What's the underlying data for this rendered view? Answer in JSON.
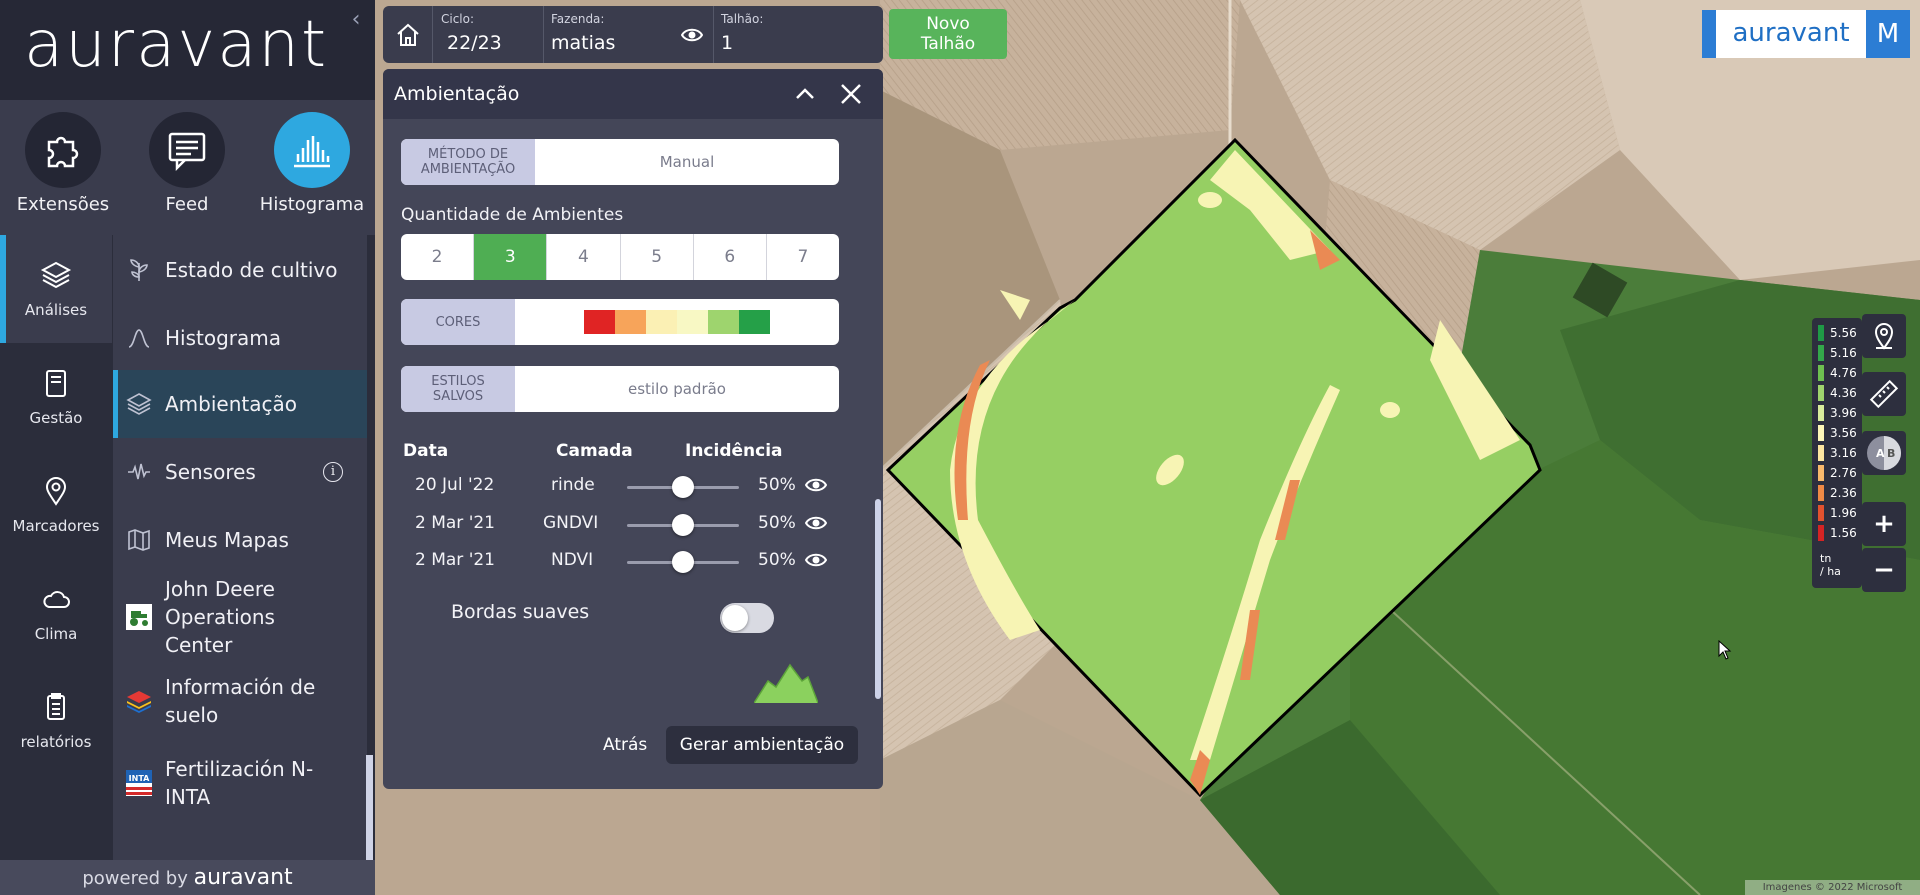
{
  "app": {
    "logo_text": "auravant",
    "collapse": "‹"
  },
  "top_apps": [
    {
      "label": "Extensões",
      "icon": "puzzle-icon"
    },
    {
      "label": "Feed",
      "icon": "chat-icon"
    },
    {
      "label": "Histograma",
      "icon": "histogram-icon"
    }
  ],
  "rail": [
    {
      "label": "Análises",
      "icon": "layers-icon",
      "active": true
    },
    {
      "label": "Gestão",
      "icon": "clipboard-icon"
    },
    {
      "label": "Marcadores",
      "icon": "pin-icon"
    },
    {
      "label": "Clima",
      "icon": "cloud-icon"
    },
    {
      "label": "relatórios",
      "icon": "report-icon"
    }
  ],
  "menu": [
    {
      "label": "Estado de cultivo",
      "icon": "plant-icon"
    },
    {
      "label": "Histograma",
      "icon": "curve-icon"
    },
    {
      "label": "Ambientação",
      "icon": "layers-icon",
      "active": true
    },
    {
      "label": "Sensores",
      "icon": "pulse-icon",
      "info": "i"
    },
    {
      "label": "Meus Mapas",
      "icon": "map-icon"
    },
    {
      "label": "John Deere Operations Center",
      "icon": "tractor-icon"
    },
    {
      "label": "Información de suelo",
      "icon": "soil-layers-icon"
    },
    {
      "label": "Fertilización N-INTA",
      "icon": "inta-icon",
      "badge": "INTA"
    }
  ],
  "powered": {
    "prefix": "powered by",
    "brand": "auravant"
  },
  "topbar": {
    "ciclo_caption": "Ciclo:",
    "ciclo_value": "22/23",
    "fazenda_caption": "Fazenda:",
    "fazenda_value": "matias",
    "talhao_caption": "Talhão:",
    "talhao_value": "1"
  },
  "novo_talhao": {
    "line1": "Novo",
    "line2": "Talhão"
  },
  "panel": {
    "title": "Ambientação",
    "metodo_label_1": "MÉTODO DE",
    "metodo_label_2": "AMBIENTAÇÃO",
    "metodo_value": "Manual",
    "qtd_label": "Quantidade de Ambientes",
    "qtd_options": [
      "2",
      "3",
      "4",
      "5",
      "6",
      "7"
    ],
    "qtd_selected": "3",
    "cores_label": "CORES",
    "cores": [
      "#e02424",
      "#f7a45a",
      "#fbf0b4",
      "#f8f8c4",
      "#9ed46e",
      "#25a048"
    ],
    "estilos_label_1": "ESTILOS",
    "estilos_label_2": "SALVOS",
    "estilos_value": "estilo padrão",
    "table_headers": {
      "data": "Data",
      "camada": "Camada",
      "incidencia": "Incidência"
    },
    "rows": [
      {
        "date": "20 Jul '22",
        "layer": "rinde",
        "pct": "50%",
        "value": 0.5
      },
      {
        "date": "2 Mar '21",
        "layer": "GNDVI",
        "pct": "50%",
        "value": 0.5
      },
      {
        "date": "2 Mar '21",
        "layer": "NDVI",
        "pct": "50%",
        "value": 0.5
      }
    ],
    "bordas_label": "Bordas suaves",
    "btn_atras": "Atrás",
    "btn_gerar": "Gerar ambientação"
  },
  "brand_box": {
    "logo": "auravant",
    "user": "M"
  },
  "legend": {
    "items": [
      {
        "value": "5.56",
        "color": "#1f9a46"
      },
      {
        "value": "5.16",
        "color": "#33a84a"
      },
      {
        "value": "4.76",
        "color": "#6ec050"
      },
      {
        "value": "4.36",
        "color": "#9fd46d"
      },
      {
        "value": "3.96",
        "color": "#d9ec9c"
      },
      {
        "value": "3.56",
        "color": "#fdf6b8"
      },
      {
        "value": "3.16",
        "color": "#fde6a0"
      },
      {
        "value": "2.76",
        "color": "#f9b96c"
      },
      {
        "value": "2.36",
        "color": "#f08a46"
      },
      {
        "value": "1.96",
        "color": "#e2522f"
      },
      {
        "value": "1.56",
        "color": "#d42424"
      }
    ],
    "unit_1": "tn",
    "unit_2": "/ ha"
  },
  "map_controls": {
    "ab_a": "A",
    "ab_b": "B",
    "zoom_in": "+",
    "zoom_out": "−"
  },
  "attribution": "Imagenes © 2022 Microsoft"
}
